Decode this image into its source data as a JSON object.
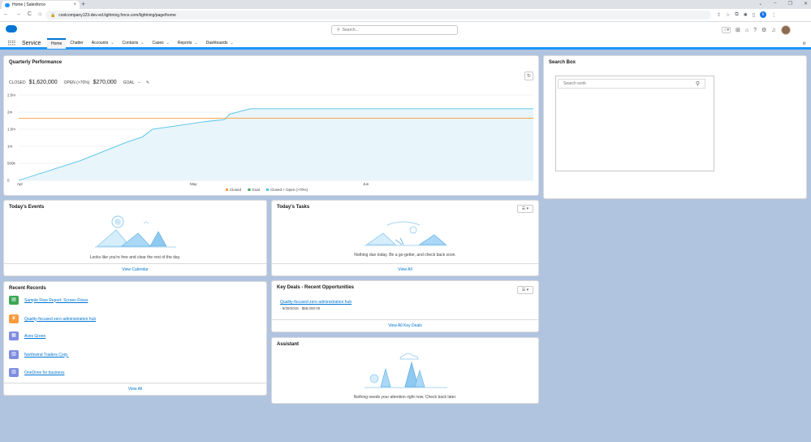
{
  "browser": {
    "tab_title": "Home | Salesforce",
    "tab_close": "×",
    "new_tab": "+",
    "url": "coolcompany123-dev-ed.lightning.force.com/lightning/page/home",
    "window_controls": [
      "⌄",
      "–",
      "❐",
      "✕"
    ],
    "nav_buttons": [
      "←",
      "→",
      "C",
      "⌂"
    ],
    "profile_letter": "k"
  },
  "header": {
    "search_placeholder": "Search...",
    "app_name": "Service"
  },
  "nav": {
    "items": [
      {
        "label": "Home",
        "chevron": ""
      },
      {
        "label": "Chatter",
        "chevron": ""
      },
      {
        "label": "Accounts",
        "chevron": "⌄"
      },
      {
        "label": "Contacts",
        "chevron": "⌄"
      },
      {
        "label": "Cases",
        "chevron": "⌄"
      },
      {
        "label": "Reports",
        "chevron": "⌄"
      },
      {
        "label": "Dashboards",
        "chevron": "⌄"
      }
    ]
  },
  "quarterly": {
    "title": "Quarterly Performance",
    "closed_label": "CLOSED",
    "closed_value": "$1,620,000",
    "open_label": "OPEN (>70%)",
    "open_value": "$270,000",
    "goal_label": "GOAL",
    "goal_value": "--",
    "edit_icon": "✎",
    "refresh_icon": "↻"
  },
  "chart_data": {
    "type": "line",
    "x_ticks": [
      "Apr",
      "May",
      "Jun"
    ],
    "y_ticks": [
      "0",
      "500k",
      "1m",
      "1.5m",
      "2m",
      "2.5m"
    ],
    "ylim": [
      0,
      2500000
    ],
    "legend": [
      "Closed",
      "Goal",
      "Closed + Open (>70%)"
    ],
    "legend_position": "bottom",
    "series": [
      {
        "name": "Closed + Open (>70%)",
        "color": "#4fc3e8",
        "x": [
          0,
          0.12,
          0.21,
          0.24,
          0.26,
          0.33,
          0.36,
          0.4,
          0.41,
          0.45,
          1.0
        ],
        "y": [
          0,
          580000,
          1120000,
          1270000,
          1500000,
          1650000,
          1720000,
          1780000,
          1940000,
          2100000,
          2100000
        ]
      },
      {
        "name": "Closed",
        "color": "#ff9a3c",
        "x": [
          0,
          1
        ],
        "y": [
          1820000,
          1820000
        ]
      }
    ]
  },
  "search_box": {
    "title": "Search Box",
    "placeholder": "Search work"
  },
  "events": {
    "title": "Today's Events",
    "empty": "Looks like you're free and clear the rest of the day.",
    "footer": "View Calendar"
  },
  "tasks": {
    "title": "Today's Tasks",
    "empty": "Nothing due today. Be a go-getter, and check back soon.",
    "footer": "View All",
    "menu": "☰ ▾"
  },
  "recent": {
    "title": "Recent Records",
    "items": [
      {
        "label": "Sample Flow Report: Screen Flows",
        "color": "#3ba755",
        "icon": "▤"
      },
      {
        "label": "Quality-focused zero administration hub",
        "color": "#ff9a3c",
        "icon": "♛"
      },
      {
        "label": "Aves Green",
        "color": "#7f8de1",
        "icon": "▦"
      },
      {
        "label": "Northwind Traders Corp.",
        "color": "#7f8de1",
        "icon": "▥"
      },
      {
        "label": "OneDrive for business",
        "color": "#7f8de1",
        "icon": "▥"
      }
    ],
    "footer": "View All"
  },
  "deals": {
    "title": "Key Deals - Recent Opportunities",
    "name": "Quality-focused zero administration hub",
    "meta": "· 6/29/2016 · $58,000.00",
    "footer": "View All Key Deals",
    "menu": "☰ ▾"
  },
  "assistant": {
    "title": "Assistant",
    "empty": "Nothing needs your attention right now. Check back later."
  }
}
